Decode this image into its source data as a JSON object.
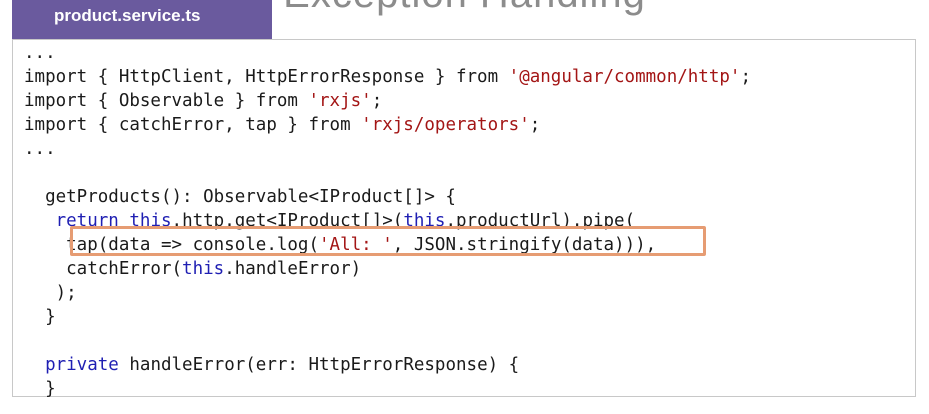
{
  "slide": {
    "title": "Exception Handling"
  },
  "tab": {
    "filename": "product.service.ts"
  },
  "code": {
    "l1": "...",
    "l2": {
      "a": "import { HttpClient, HttpErrorResponse } from ",
      "s": "'@angular/common/http'",
      "b": ";"
    },
    "l3": {
      "a": "import { Observable } from ",
      "s": "'rxjs'",
      "b": ";"
    },
    "l4": {
      "a": "import { catchError, tap } from ",
      "s": "'rxjs/operators'",
      "b": ";"
    },
    "l5": "...",
    "l7": "  getProducts(): Observable<IProduct[]> {",
    "l8": {
      "indent": "   ",
      "kw1": "return",
      "sp": " ",
      "kw2": "this",
      "mid": ".http.get<IProduct[]>(",
      "kw3": "this",
      "end": ".productUrl).pipe("
    },
    "l9": {
      "a": "    tap(data => console.log(",
      "s": "'All: '",
      "b": ", JSON.stringify(data))),"
    },
    "l10": {
      "a": "    catchError(",
      "kw": "this",
      "b": ".handleError)"
    },
    "l11": "   );",
    "l12": "  }",
    "l14": {
      "indent": "  ",
      "kw": "private",
      "b": " handleError(err: HttpErrorResponse) {"
    },
    "l15": "  }"
  }
}
